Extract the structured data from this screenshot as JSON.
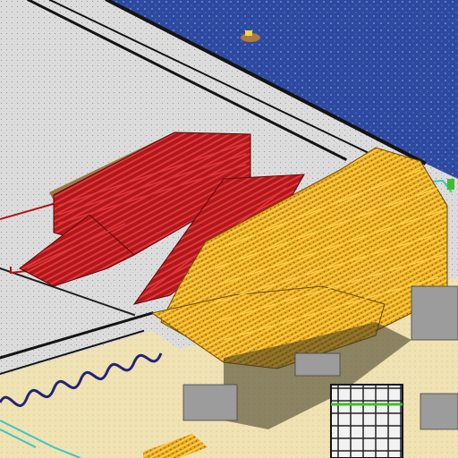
{
  "scene": {
    "kind": "isometric-sandbox-world",
    "colors": {
      "water": "#2e4aa0",
      "water_dot": "#6f86d6",
      "concrete": "#dcdcdc",
      "concrete_dot": "#9a9a9a",
      "sand": "#efe2b3",
      "sand_dark": "#d9c98f",
      "red_rails": "#b0171b",
      "red_rails_light": "#e0383a",
      "gold_rails": "#e6a61c",
      "gold_rails_light": "#ffd24a",
      "wall_dark": "#141414",
      "blue_wire": "#23237a",
      "cyan_wire": "#38c6c6",
      "brown_platform": "#a0773e",
      "white_block": "#f2f2f2",
      "green_trim": "#3cbf2c",
      "shadow": "#3b3520"
    },
    "objects": [
      {
        "name": "ocean",
        "kind": "water-area"
      },
      {
        "name": "concrete-floor",
        "kind": "floor"
      },
      {
        "name": "sand-floor",
        "kind": "floor"
      },
      {
        "name": "red-rail-ramp",
        "kind": "structure"
      },
      {
        "name": "gold-rail-tower",
        "kind": "structure"
      },
      {
        "name": "blue-wire",
        "kind": "wire"
      },
      {
        "name": "cyan-wire",
        "kind": "wire"
      },
      {
        "name": "white-grid-block",
        "kind": "structure"
      },
      {
        "name": "small-boat",
        "kind": "entity"
      }
    ]
  }
}
